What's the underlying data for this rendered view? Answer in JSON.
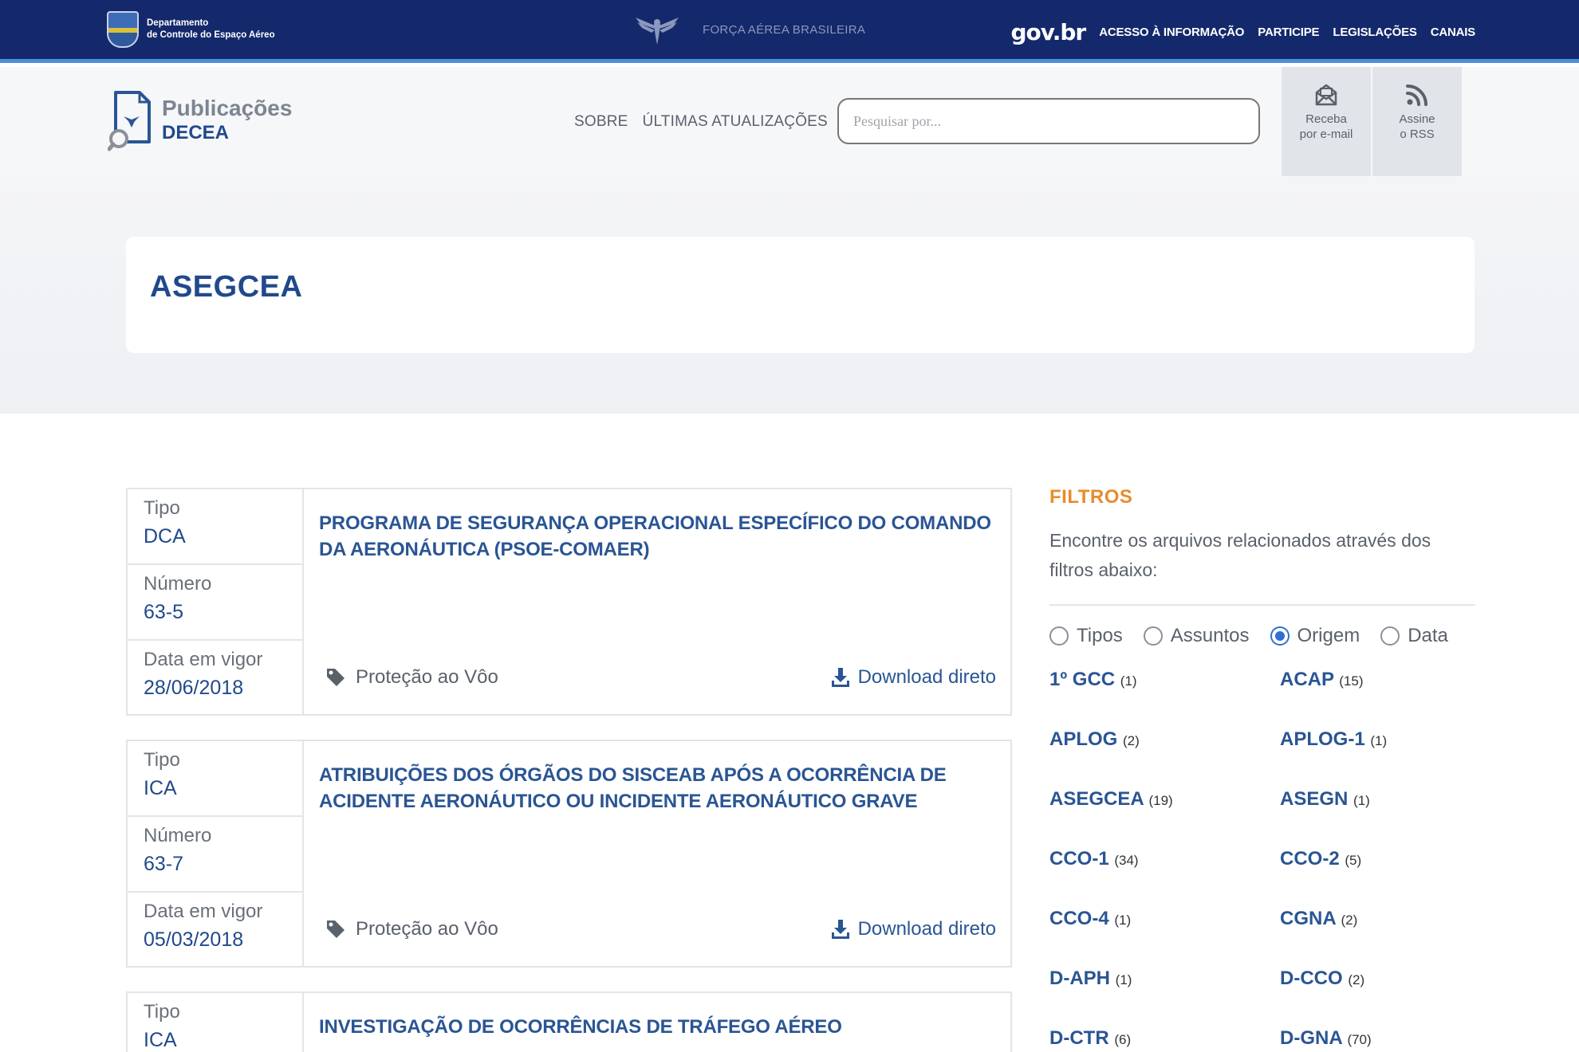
{
  "govbar": {
    "logo_line1": "Departamento",
    "logo_line2": "de Controle do Espaço Aéreo",
    "fab_text": "FORÇA AÉREA BRASILEIRA",
    "govbr": "gov.br",
    "links": [
      "ACESSO À INFORMAÇÃO",
      "PARTICIPE",
      "LEGISLAÇÕES",
      "CANAIS"
    ]
  },
  "header": {
    "brand_line1": "Publicações",
    "brand_line2": "DECEA",
    "nav": [
      "SOBRE",
      "ÚLTIMAS ATUALIZAÇÕES"
    ],
    "search_placeholder": "Pesquisar por...",
    "email_btn": [
      "Receba",
      "por e-mail"
    ],
    "rss_btn": [
      "Assine",
      "o RSS"
    ]
  },
  "hero": {
    "title": "ASEGCEA"
  },
  "labels": {
    "tipo": "Tipo",
    "numero": "Número",
    "data": "Data em vigor",
    "download": "Download direto"
  },
  "publications": [
    {
      "tipo": "DCA",
      "numero": "63-5",
      "data": "28/06/2018",
      "title": "PROGRAMA DE SEGURANÇA OPERACIONAL ESPECÍFICO DO COMANDO DA AERONÁUTICA (PSOE-COMAER)",
      "tag": "Proteção ao Vôo"
    },
    {
      "tipo": "ICA",
      "numero": "63-7",
      "data": "05/03/2018",
      "title": "ATRIBUIÇÕES DOS ÓRGÃOS DO SISCEAB APÓS A OCORRÊNCIA DE ACIDENTE AERONÁUTICO OU INCIDENTE AERONÁUTICO GRAVE",
      "tag": "Proteção ao Vôo"
    },
    {
      "tipo": "ICA",
      "numero": "",
      "data": "",
      "title": "INVESTIGAÇÃO DE OCORRÊNCIAS DE TRÁFEGO AÉREO",
      "tag": ""
    }
  ],
  "filters": {
    "title": "FILTROS",
    "description": "Encontre os arquivos relacionados através dos filtros abaixo:",
    "radios": [
      {
        "label": "Tipos",
        "selected": false
      },
      {
        "label": "Assuntos",
        "selected": false
      },
      {
        "label": "Origem",
        "selected": true
      },
      {
        "label": "Data",
        "selected": false
      }
    ],
    "items": [
      {
        "name": "1º GCC",
        "count": "(1)"
      },
      {
        "name": "ACAP",
        "count": "(15)"
      },
      {
        "name": "APLOG",
        "count": "(2)"
      },
      {
        "name": "APLOG-1",
        "count": "(1)"
      },
      {
        "name": "ASEGCEA",
        "count": "(19)"
      },
      {
        "name": "ASEGN",
        "count": "(1)"
      },
      {
        "name": "CCO-1",
        "count": "(34)"
      },
      {
        "name": "CCO-2",
        "count": "(5)"
      },
      {
        "name": "CCO-4",
        "count": "(1)"
      },
      {
        "name": "CGNA",
        "count": "(2)"
      },
      {
        "name": "D-APH",
        "count": "(1)"
      },
      {
        "name": "D-CCO",
        "count": "(2)"
      },
      {
        "name": "D-CTR",
        "count": "(6)"
      },
      {
        "name": "D-GNA",
        "count": "(70)"
      }
    ]
  }
}
